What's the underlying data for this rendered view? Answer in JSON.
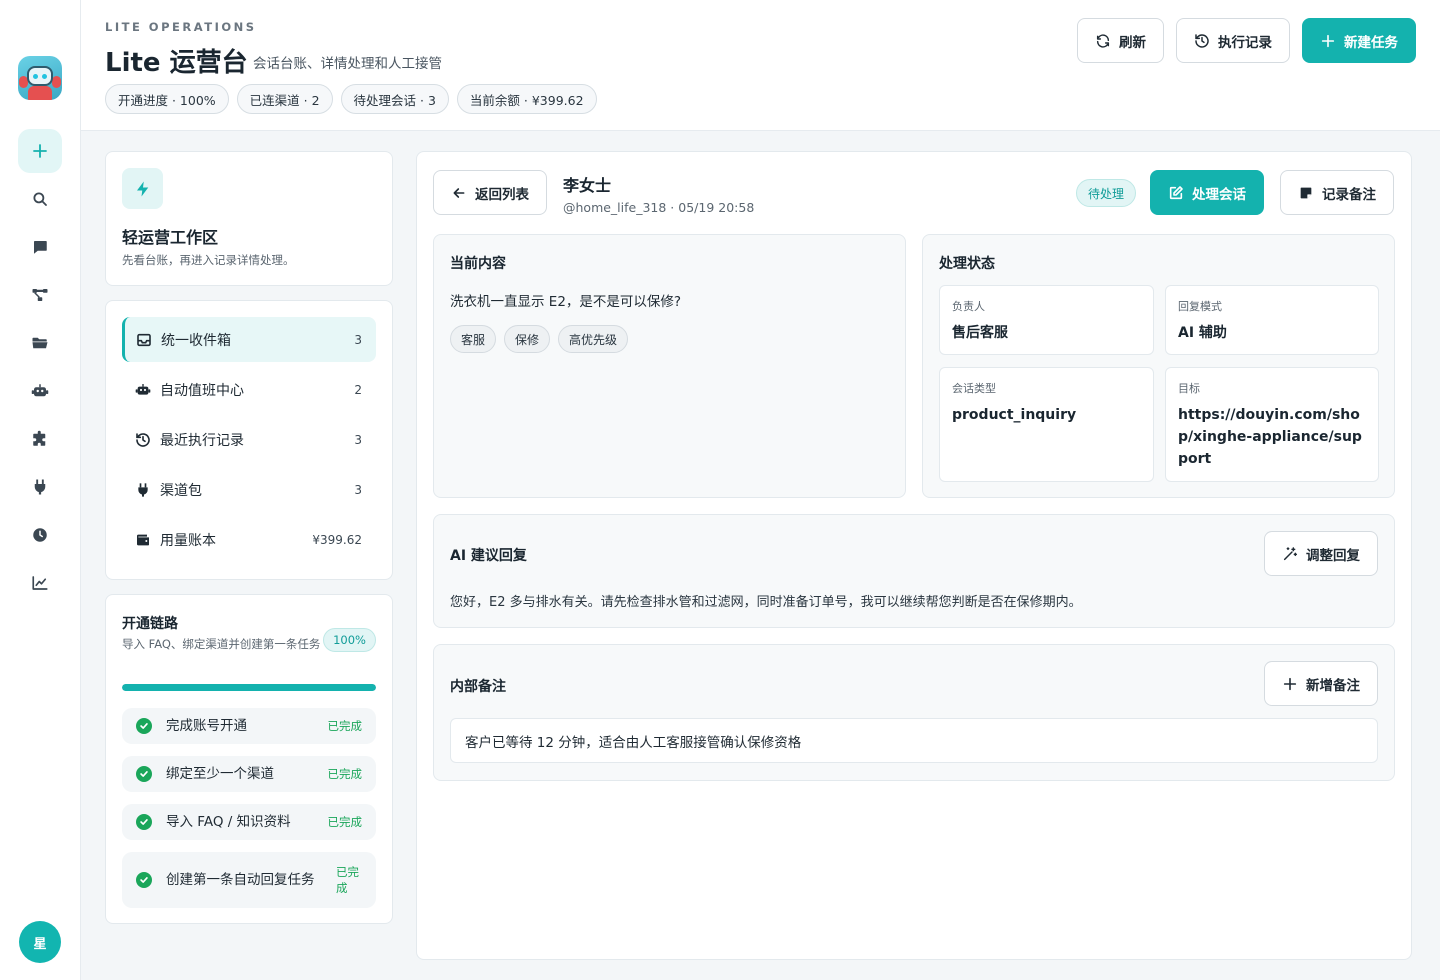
{
  "rail": {
    "avatar_text": "星"
  },
  "header": {
    "eyebrow": "LITE OPERATIONS",
    "title": "Lite 运营台",
    "subtitle": "会话台账、详情处理和人工接管",
    "chips": [
      "开通进度 · 100%",
      "已连渠道 · 2",
      "待处理会话 · 3",
      "当前余额 · ¥399.62"
    ],
    "actions": {
      "refresh": "刷新",
      "history": "执行记录",
      "new_task": "新建任务"
    }
  },
  "workspace": {
    "title": "轻运营工作区",
    "desc": "先看台账，再进入记录详情处理。"
  },
  "nav": {
    "items": [
      {
        "label": "统一收件箱",
        "count": "3"
      },
      {
        "label": "自动值班中心",
        "count": "2"
      },
      {
        "label": "最近执行记录",
        "count": "3"
      },
      {
        "label": "渠道包",
        "count": "3"
      },
      {
        "label": "用量账本",
        "count": "¥399.62"
      }
    ]
  },
  "onboarding": {
    "title": "开通链路",
    "desc": "导入 FAQ、绑定渠道并创建第一条任务",
    "percent": "100%",
    "progress": 1.0,
    "steps": [
      {
        "label": "完成账号开通",
        "status": "已完成"
      },
      {
        "label": "绑定至少一个渠道",
        "status": "已完成"
      },
      {
        "label": "导入 FAQ / 知识资料",
        "status": "已完成"
      },
      {
        "label": "创建第一条自动回复任务",
        "status": "已完成"
      }
    ]
  },
  "detail": {
    "back": "返回列表",
    "customer": "李女士",
    "meta": "@home_life_318 · 05/19 20:58",
    "status": "待处理",
    "handle": "处理会话",
    "record_note": "记录备注",
    "content": {
      "title": "当前内容",
      "message": "洗衣机一直显示 E2，是不是可以保修?",
      "tags": [
        "客服",
        "保修",
        "高优先级"
      ]
    },
    "state": {
      "title": "处理状态",
      "fields": [
        {
          "key": "负责人",
          "value": "售后客服"
        },
        {
          "key": "回复模式",
          "value": "AI 辅助"
        },
        {
          "key": "会话类型",
          "value": "product_inquiry"
        },
        {
          "key": "目标",
          "value": "https://douyin.com/shop/xinghe-appliance/support"
        }
      ]
    },
    "ai": {
      "title": "AI 建议回复",
      "button": "调整回复",
      "text": "您好，E2 多与排水有关。请先检查排水管和过滤网，同时准备订单号，我可以继续帮您判断是否在保修期内。"
    },
    "notes": {
      "title": "内部备注",
      "button": "新增备注",
      "text": "客户已等待 12 分钟，适合由人工客服接管确认保修资格"
    }
  },
  "colors": {
    "accent": "#14b2ae",
    "success": "#1aa65a"
  }
}
